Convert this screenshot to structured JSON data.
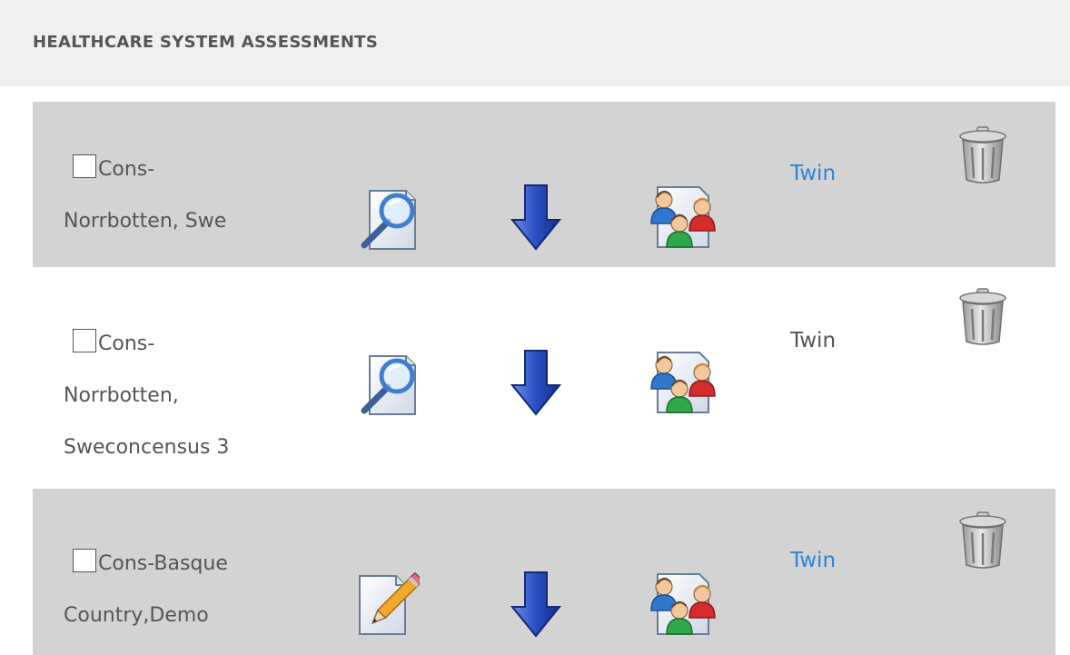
{
  "page_title": "HEALTHCARE SYSTEM ASSESSMENTS",
  "colors": {
    "header_bg": "#f0f0f0",
    "row_shaded": "#d3d3d3",
    "link": "#2b86d6",
    "text": "#555555"
  },
  "rows": [
    {
      "name_line1": "Cons-",
      "name_line2": "Norrbotten, Swe",
      "name_line3": "",
      "action1": "view-icon",
      "action2": "download-icon",
      "action3": "team-document-icon",
      "twin_label": "Twin",
      "twin_is_link": true,
      "delete": "trash-icon"
    },
    {
      "name_line1": "Cons-",
      "name_line2": "Norrbotten,",
      "name_line3": "Sweconcensus 3",
      "action1": "view-icon",
      "action2": "download-icon",
      "action3": "team-document-icon",
      "twin_label": "Twin",
      "twin_is_link": false,
      "delete": "trash-icon"
    },
    {
      "name_line1": "Cons-Basque",
      "name_line2": "Country,Demo",
      "name_line3": "",
      "action1": "edit-icon",
      "action2": "download-icon",
      "action3": "team-document-icon",
      "twin_label": "Twin",
      "twin_is_link": true,
      "delete": "trash-icon"
    }
  ]
}
